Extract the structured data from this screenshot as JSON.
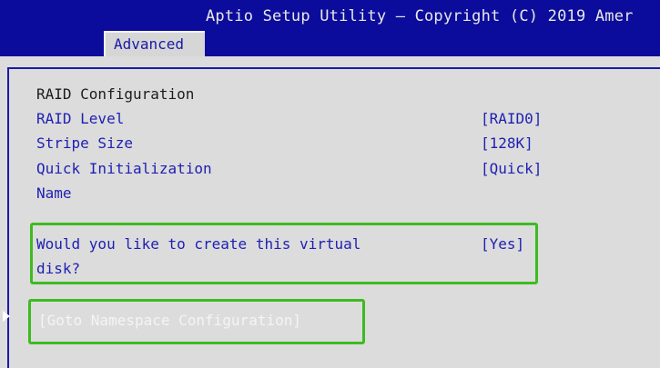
{
  "header": {
    "title": "Aptio Setup Utility – Copyright (C) 2019 Amer",
    "tab": "Advanced"
  },
  "settings": {
    "section_title": "RAID Configuration",
    "raid_level": {
      "label": "RAID Level",
      "value": "[RAID0]"
    },
    "stripe_size": {
      "label": "Stripe Size",
      "value": "[128K]"
    },
    "quick_init": {
      "label": "Quick Initialization",
      "value": "[Quick]"
    },
    "name": {
      "label": "Name"
    },
    "create_disk": {
      "label_line1": "Would you like to create this virtual",
      "label_line2": "disk?",
      "value": "[Yes]"
    },
    "goto_namespace": "[Goto Namespace Configuration]"
  },
  "colors": {
    "header_bg": "#0c0c9c",
    "panel_bg": "#dcdcdc",
    "text_blue": "#2020b4",
    "highlight_green": "#3dbb21"
  },
  "icons": {
    "submenu": "submenu-arrow-icon"
  }
}
